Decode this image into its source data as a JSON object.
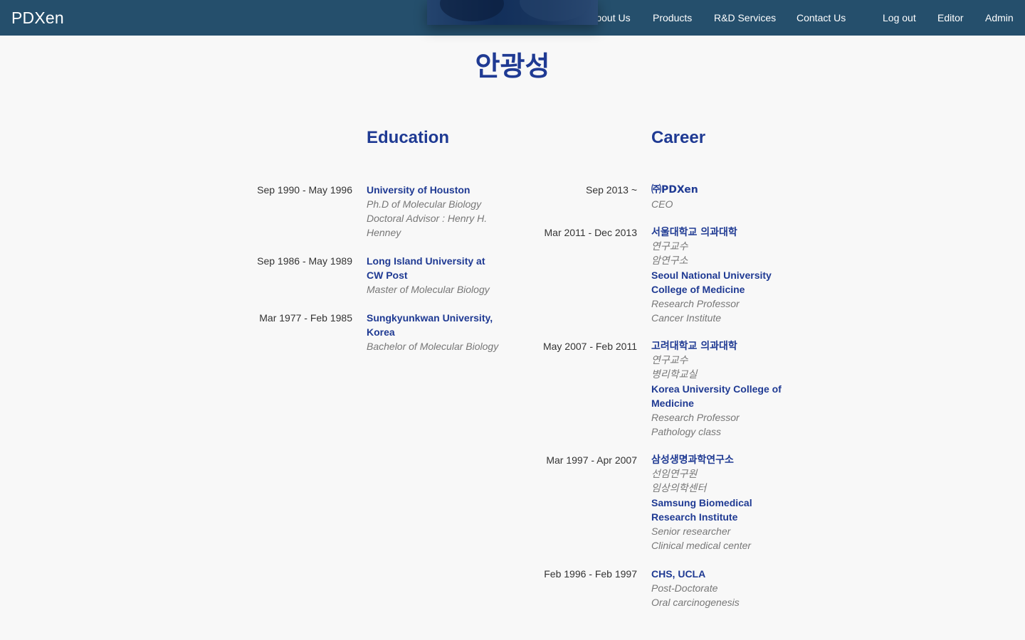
{
  "navbar": {
    "brand": "PDXen",
    "links": [
      "About Us",
      "Products",
      "R&D Services",
      "Contact Us",
      "Log out",
      "Editor",
      "Admin"
    ]
  },
  "profile": {
    "name": "안광성"
  },
  "education": {
    "title": "Education",
    "entries": [
      {
        "date": "Sep 1990 - May 1996",
        "org": "University of Houston",
        "lines": [
          "Ph.D of Molecular Biology",
          "Doctoral Advisor : Henry H.",
          "Henney"
        ]
      },
      {
        "date": "Sep 1986 - May 1989",
        "org": [
          "Long Island University at",
          "CW Post"
        ],
        "lines": [
          "Master of Molecular Biology"
        ]
      },
      {
        "date": "Mar 1977 - Feb 1985",
        "org": [
          "Sungkyunkwan University,",
          "Korea"
        ],
        "lines": [
          "Bachelor of Molecular Biology"
        ]
      }
    ]
  },
  "career": {
    "title": "Career",
    "entries": [
      {
        "date": "Sep 2013 ~",
        "org": "㈜PDXen",
        "lines": [
          "CEO"
        ]
      },
      {
        "date": "Mar 2011 - Dec 2013",
        "org": "서울대학교 의과대학",
        "lines": [
          "연구교수",
          "암연구소"
        ],
        "org2": [
          "Seoul National University",
          "College of Medicine"
        ],
        "lines2": [
          "Research Professor",
          "Cancer Institute"
        ]
      },
      {
        "date": "May 2007 - Feb 2011",
        "org": "고려대학교 의과대학",
        "lines": [
          "연구교수",
          "병리학교실"
        ],
        "org2": [
          "Korea University College of",
          "Medicine"
        ],
        "lines2": [
          "Research Professor",
          "Pathology class"
        ]
      },
      {
        "date": "Mar 1997 - Apr 2007",
        "org": "삼성생명과학연구소",
        "lines": [
          "선임연구원",
          "임상의학센터"
        ],
        "org2": [
          "Samsung Biomedical",
          "Research Institute"
        ],
        "lines2": [
          "Senior researcher",
          "Clinical medical center"
        ]
      },
      {
        "date": "Feb 1996 - Feb 1997",
        "org": "CHS, UCLA",
        "lines": [
          "Post-Doctorate",
          "Oral carcinogenesis"
        ]
      }
    ]
  }
}
